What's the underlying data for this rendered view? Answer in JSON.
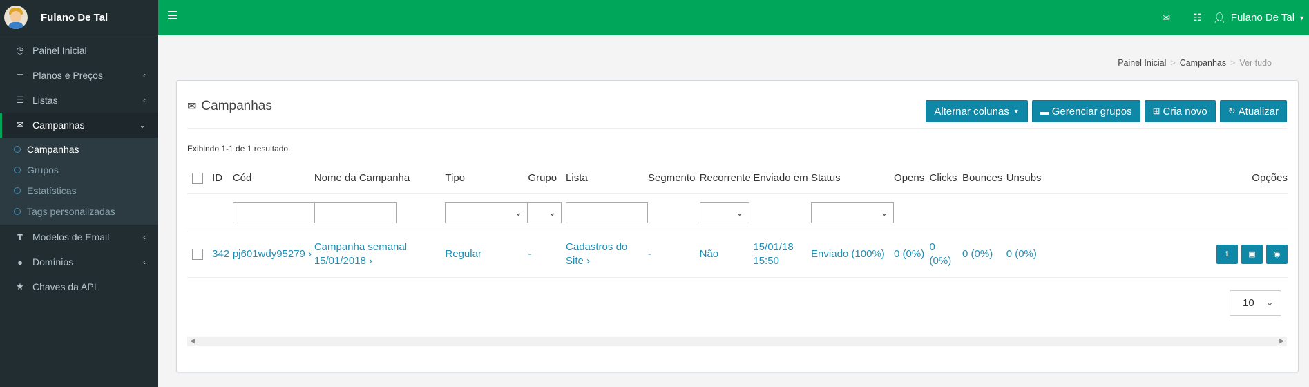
{
  "user": {
    "name": "Fulano De Tal"
  },
  "sidebar": {
    "items": [
      {
        "label": "Painel Inicial",
        "icon": "dashboard-icon"
      },
      {
        "label": "Planos e Preços",
        "icon": "credit-card-icon",
        "arrow": "‹"
      },
      {
        "label": "Listas",
        "icon": "list-icon",
        "arrow": "‹"
      },
      {
        "label": "Campanhas",
        "icon": "envelope-icon",
        "arrow": "⌄"
      },
      {
        "label": "Modelos de Email",
        "icon": "text-icon",
        "arrow": "‹"
      },
      {
        "label": "Domínios",
        "icon": "globe-icon",
        "arrow": "‹"
      },
      {
        "label": "Chaves da API",
        "icon": "star-icon"
      }
    ],
    "subitems": [
      {
        "label": "Campanhas"
      },
      {
        "label": "Grupos"
      },
      {
        "label": "Estatísticas"
      },
      {
        "label": "Tags personalizadas"
      }
    ]
  },
  "header": {
    "user_label": "Fulano De Tal"
  },
  "breadcrumb": {
    "home": "Painel Inicial",
    "section": "Campanhas",
    "current": "Ver tudo"
  },
  "box": {
    "title": "Campanhas",
    "buttons": {
      "toggle_columns": "Alternar colunas",
      "manage_groups": "Gerenciar grupos",
      "create_new": "Cria novo",
      "refresh": "Atualizar"
    },
    "summary": "Exibindo 1-1 de 1 resultado."
  },
  "table": {
    "columns": [
      "ID",
      "Cód",
      "Nome da Campanha",
      "Tipo",
      "Grupo",
      "Lista",
      "Segmento",
      "Recorrente",
      "Enviado em",
      "Status",
      "Opens",
      "Clicks",
      "Bounces",
      "Unsubs",
      "Opções"
    ],
    "row": {
      "id": "342",
      "cod": "pj601wdy95279 ›",
      "name_line1": "Campanha semanal",
      "name_line2": "15/01/2018 ›",
      "tipo": "Regular",
      "grupo": "-",
      "lista_line1": "Cadastros do",
      "lista_line2": "Site ›",
      "segmento": "-",
      "recorrente": "Não",
      "enviado_line1": "15/01/18",
      "enviado_line2": "15:50",
      "status": "Enviado (100%)",
      "opens": "0 (0%)",
      "clicks_line1": "0",
      "clicks_line2": "(0%)",
      "bounces": "0 (0%)",
      "unsubs": "0 (0%)"
    }
  },
  "pager": {
    "page_size": "10"
  },
  "colors": {
    "header": "#00a65a",
    "sidebar": "#222d32",
    "button": "#0e88a6",
    "link": "#1f8fb5"
  }
}
